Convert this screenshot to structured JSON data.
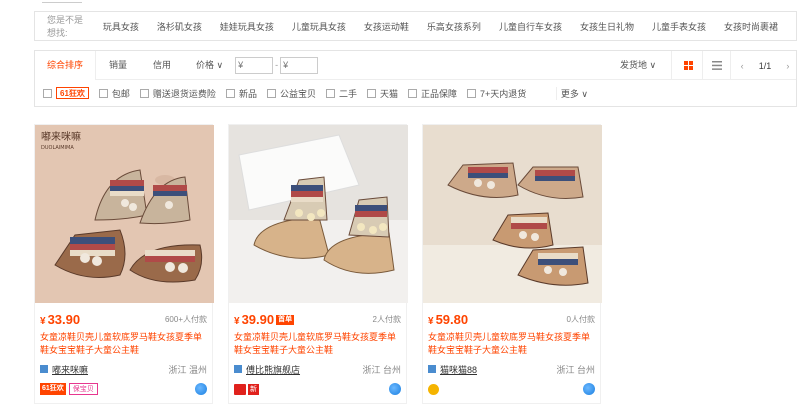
{
  "suggest": {
    "label": "您是不是想找:",
    "items": [
      "玩具女孩",
      "洛杉矶女孩",
      "娃娃玩具女孩",
      "儿童玩具女孩",
      "女孩运动鞋",
      "乐高女孩系列",
      "儿童自行车女孩",
      "女孩生日礼物",
      "儿童手表女孩",
      "女孩时尚裹裙"
    ]
  },
  "sort": {
    "tabs": [
      "综合排序",
      "销量",
      "信用",
      "价格"
    ],
    "price_min_placeholder": "¥",
    "price_max_placeholder": "¥",
    "price_sep": "-",
    "ship_from": "发货地",
    "pager": {
      "page": "1/1"
    }
  },
  "filters": {
    "badge_61": "61狂欢",
    "items": [
      "包邮",
      "赠送退货运费险",
      "新品",
      "公益宝贝",
      "二手",
      "天猫",
      "正品保障",
      "7+天内退货"
    ],
    "more": "更多"
  },
  "products": [
    {
      "price": "33.90",
      "currency": "¥",
      "first_badge": "",
      "deal_count": "600+人付款",
      "title": "女童凉鞋贝壳儿童软底罗马鞋女孩夏季单鞋女宝宝鞋子大童公主鞋",
      "shop": "嘟来咪嘛",
      "location": "浙江 温州",
      "badges": [
        "61狂欢",
        "保宝贝"
      ],
      "image_brand": "嘟来咪嘛",
      "image_brand_en": "DUOLAIMIMA"
    },
    {
      "price": "39.90",
      "currency": "¥",
      "first_badge": "首单",
      "deal_count": "2人付款",
      "title": "女童凉鞋贝壳儿童软底罗马鞋女孩夏季单鞋女宝宝鞋子大童公主鞋",
      "shop": "傅比熊旗舰店",
      "location": "浙江 台州",
      "badges": [
        "新"
      ],
      "image_brand": "",
      "image_brand_en": ""
    },
    {
      "price": "59.80",
      "currency": "¥",
      "first_badge": "",
      "deal_count": "0人付款",
      "title": "女童凉鞋贝壳儿童软底罗马鞋女孩夏季单鞋女宝宝鞋子大童公主鞋",
      "shop": "猫咪猫88",
      "location": "浙江 台州",
      "badges": [],
      "image_brand": "",
      "image_brand_en": ""
    }
  ],
  "colors": {
    "accent": "#ff4400",
    "border": "#e4e4e4",
    "pink": "#e7368f",
    "link_blue": "#1a7fe0"
  }
}
